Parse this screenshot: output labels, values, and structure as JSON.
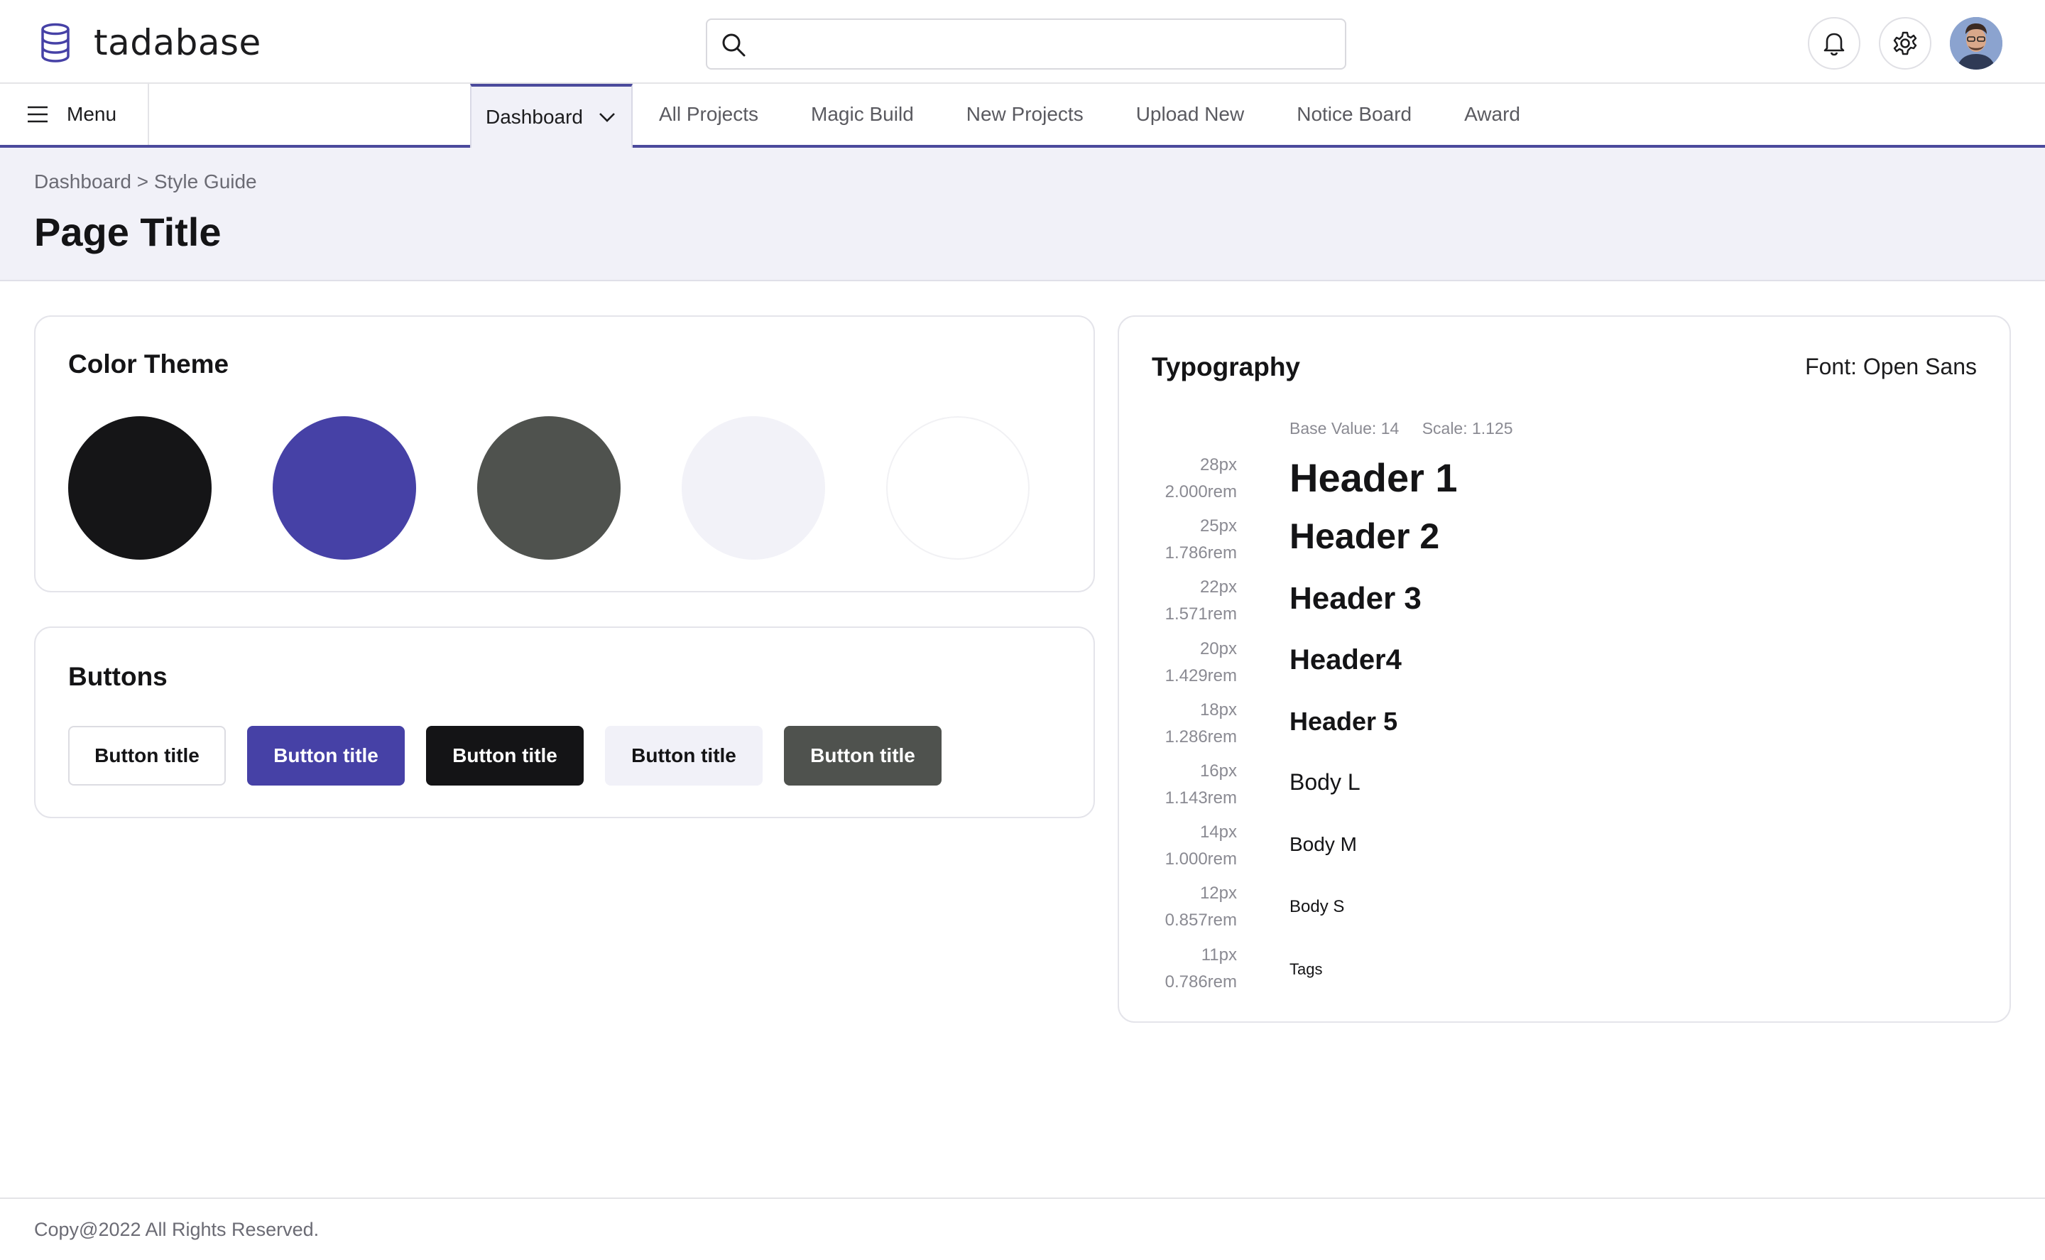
{
  "brand": {
    "name": "tadabase"
  },
  "search": {
    "value": "",
    "placeholder": ""
  },
  "nav": {
    "menu_label": "Menu",
    "tabs": [
      {
        "label": "Dashboard",
        "active": true
      },
      {
        "label": "All Projects"
      },
      {
        "label": "Magic Build"
      },
      {
        "label": "New Projects"
      },
      {
        "label": "Upload New"
      },
      {
        "label": "Notice Board"
      },
      {
        "label": "Award"
      }
    ]
  },
  "page": {
    "breadcrumb": "Dashboard > Style Guide",
    "title": "Page Title"
  },
  "color_theme": {
    "title": "Color Theme",
    "swatches": [
      "#151517",
      "#4641a6",
      "#4f524e",
      "#f2f2f8",
      "#ffffff"
    ]
  },
  "buttons": {
    "title": "Buttons",
    "items": [
      {
        "label": "Button title",
        "variant": "outline"
      },
      {
        "label": "Button title",
        "variant": "primary"
      },
      {
        "label": "Button title",
        "variant": "dark"
      },
      {
        "label": "Button title",
        "variant": "light"
      },
      {
        "label": "Button title",
        "variant": "grey"
      }
    ]
  },
  "typography": {
    "title": "Typography",
    "font_label": "Font: Open Sans",
    "base_value": "Base Value: 14",
    "scale": "Scale: 1.125",
    "rows": [
      {
        "px": "28px",
        "rem": "2.000rem",
        "sample": "Header 1"
      },
      {
        "px": "25px",
        "rem": "1.786rem",
        "sample": "Header 2"
      },
      {
        "px": "22px",
        "rem": "1.571rem",
        "sample": "Header 3"
      },
      {
        "px": "20px",
        "rem": "1.429rem",
        "sample": "Header4"
      },
      {
        "px": "18px",
        "rem": "1.286rem",
        "sample": "Header 5"
      },
      {
        "px": "16px",
        "rem": "1.143rem",
        "sample": "Body L"
      },
      {
        "px": "14px",
        "rem": "1.000rem",
        "sample": "Body M"
      },
      {
        "px": "12px",
        "rem": "0.857rem",
        "sample": "Body S"
      },
      {
        "px": "11px",
        "rem": "0.786rem",
        "sample": "Tags"
      }
    ]
  },
  "footer": {
    "text": "Copy@2022 All Rights Reserved."
  },
  "colors": {
    "accent": "#4641a6",
    "dark": "#151517",
    "grey": "#4f524e",
    "light": "#f2f2f8"
  },
  "icons": {
    "brand": "database-icon",
    "search": "search-icon",
    "notifications": "bell-icon",
    "settings": "gear-icon",
    "menu": "hamburger-icon",
    "dropdown": "chevron-down-icon"
  }
}
